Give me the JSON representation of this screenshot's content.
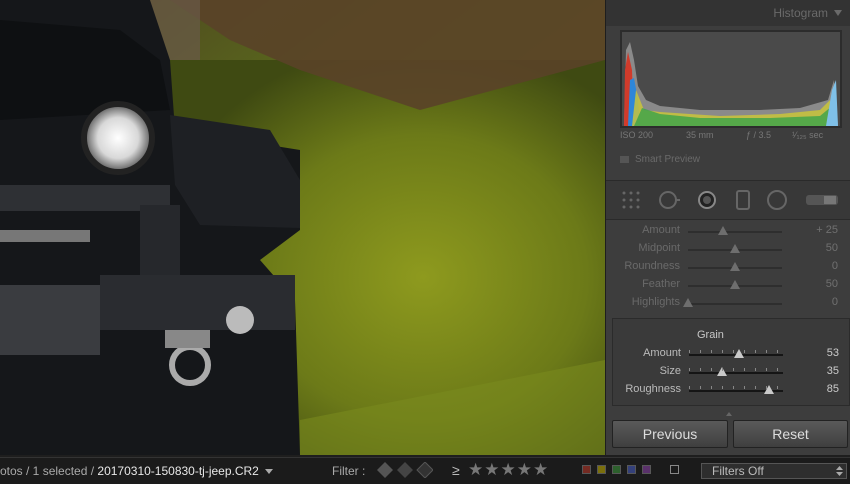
{
  "panel": {
    "histogram": {
      "title": "Histogram",
      "info": {
        "iso": "ISO 200",
        "focal": "35 mm",
        "aperture": "ƒ / 3.5",
        "shutter": "¹⁄₁₂₅ sec"
      },
      "smart_preview": "Smart Preview"
    },
    "faded_sliders": [
      {
        "label": "Amount",
        "value": "+ 25",
        "pos": 0.37
      },
      {
        "label": "Midpoint",
        "value": "50",
        "pos": 0.5
      },
      {
        "label": "Roundness",
        "value": "0",
        "pos": 0.5
      },
      {
        "label": "Feather",
        "value": "50",
        "pos": 0.5
      },
      {
        "label": "Highlights",
        "value": "0",
        "pos": 0.0
      }
    ],
    "grain": {
      "title": "Grain",
      "sliders": [
        {
          "label": "Amount",
          "value": "53",
          "pos": 0.53
        },
        {
          "label": "Size",
          "value": "35",
          "pos": 0.35
        },
        {
          "label": "Roughness",
          "value": "85",
          "pos": 0.85
        }
      ]
    },
    "buttons": {
      "previous": "Previous",
      "reset": "Reset"
    }
  },
  "filmstrip": {
    "path_prefix": "otos / 1 selected /",
    "filename": "20170310-150830-tj-jeep.CR2",
    "filter_label": "Filter :",
    "gte": "≥",
    "stars": "★★★★★",
    "color_labels": [
      "#c0392b",
      "#c8b400",
      "#3d9a3d",
      "#4a5fc8",
      "#8e44ad"
    ],
    "filters_select": "Filters Off"
  }
}
